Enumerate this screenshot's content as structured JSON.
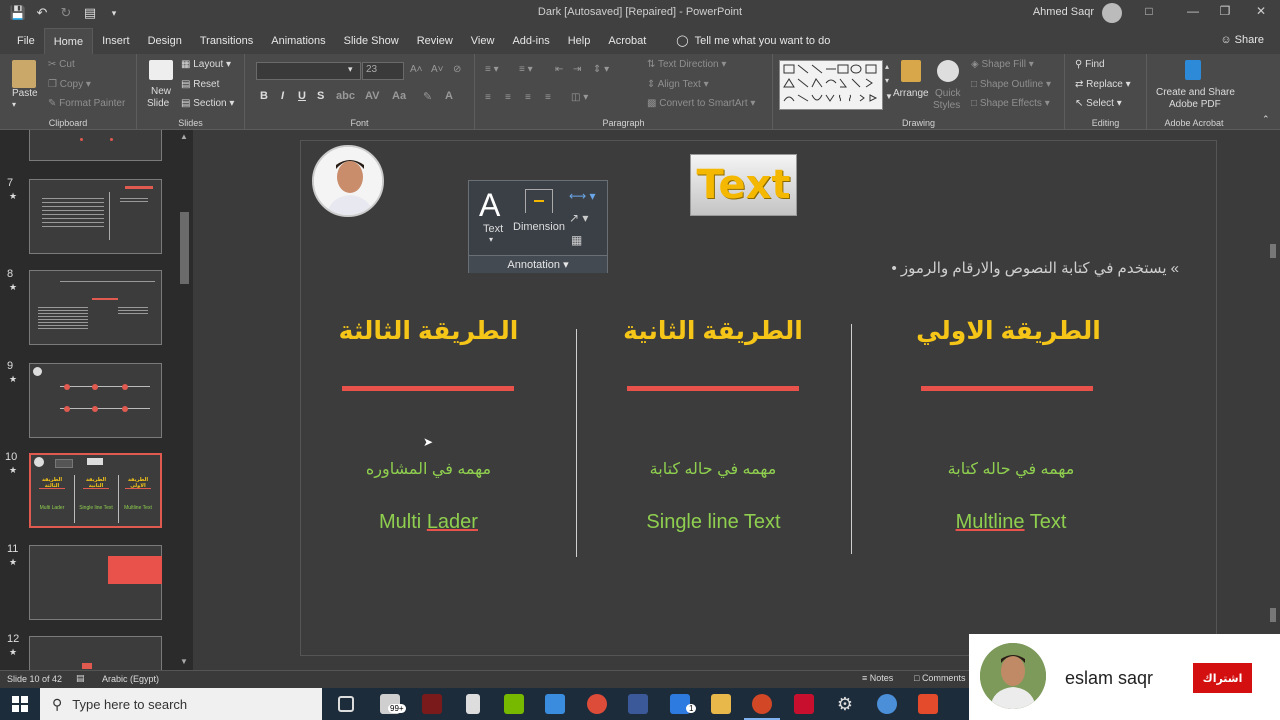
{
  "window": {
    "title": "Dark [Autosaved] [Repaired] - PowerPoint",
    "user": "Ahmed Saqr"
  },
  "tabs": [
    "File",
    "Home",
    "Insert",
    "Design",
    "Transitions",
    "Animations",
    "Slide Show",
    "Review",
    "View",
    "Add-ins",
    "Help",
    "Acrobat"
  ],
  "tell_me": "Tell me what you want to do",
  "share": "Share",
  "ribbon": {
    "clipboard": {
      "paste": "Paste",
      "cut": "Cut",
      "copy": "Copy",
      "format_painter": "Format Painter",
      "label": "Clipboard"
    },
    "slides": {
      "new_slide": "New",
      "new_slide2": "Slide",
      "layout": "Layout",
      "reset": "Reset",
      "section": "Section",
      "label": "Slides"
    },
    "font": {
      "size": "23",
      "bold": "B",
      "italic": "I",
      "underline": "U",
      "strike": "S",
      "label": "Font"
    },
    "paragraph": {
      "text_direction": "Text Direction",
      "align_text": "Align Text",
      "convert": "Convert to SmartArt",
      "label": "Paragraph"
    },
    "drawing": {
      "arrange": "Arrange",
      "quick_styles": "Quick",
      "quick_styles2": "Styles",
      "shape_fill": "Shape Fill",
      "shape_outline": "Shape Outline",
      "shape_effects": "Shape Effects",
      "label": "Drawing"
    },
    "editing": {
      "find": "Find",
      "replace": "Replace",
      "select": "Select",
      "label": "Editing"
    },
    "acrobat": {
      "create_share": "Create and Share",
      "create_share2": "Adobe PDF",
      "label": "Adobe Acrobat"
    }
  },
  "thumbnails": [
    {
      "num": "7",
      "star": "★"
    },
    {
      "num": "8",
      "star": "★"
    },
    {
      "num": "9",
      "star": "★"
    },
    {
      "num": "10",
      "star": "★",
      "selected": true
    },
    {
      "num": "11",
      "star": "★"
    },
    {
      "num": "12",
      "star": "★"
    }
  ],
  "thumb10": {
    "col1": "الطريقة الثالثة",
    "col2": "الطريقة الثانية",
    "col3": "الطريقة الاولي",
    "en1": "Multi Lader",
    "en2": "Single line Text",
    "en3": "Multline Text"
  },
  "slide": {
    "title_badge": "Text",
    "bullet": "» يستخدم في كتابة النصوص والارقام والرموز •",
    "annotation_panel": {
      "text": "Text",
      "dimension": "Dimension",
      "label": "Annotation"
    },
    "columns": [
      {
        "heading": "الطريقة الثالثة",
        "arabic": "مهمه في المشاوره",
        "english_a": "Multi",
        "english_b": "Lader"
      },
      {
        "heading": "الطريقة الثانية",
        "arabic": "مهمه في حاله كتابة",
        "english_a": "Single line Text",
        "english_b": ""
      },
      {
        "heading": "الطريقة الاولي",
        "arabic": "مهمه في حاله كتابة",
        "english_a": "Multline",
        "english_b": "Text"
      }
    ],
    "accent_color": "#e8524a",
    "heading_color": "#f5c518",
    "green_text_color": "#8fcf4f"
  },
  "status": {
    "slide_of": "Slide 10 of 42",
    "language": "Arabic (Egypt)",
    "notes": "Notes",
    "comments": "Comments"
  },
  "taskbar": {
    "search_placeholder": "Type here to search",
    "badge": "99+",
    "badge2": "1"
  },
  "overlay": {
    "name": "eslam saqr",
    "subscribe": "اشتراك"
  }
}
